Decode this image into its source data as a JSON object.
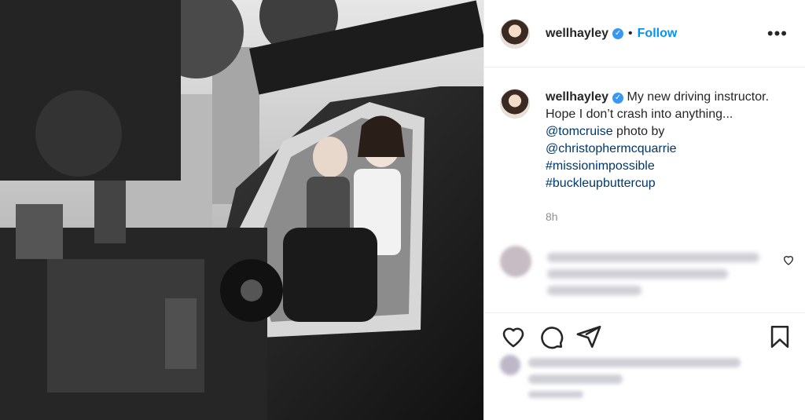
{
  "post": {
    "username": "wellhayley",
    "follow_label": "Follow",
    "more_label": "•••",
    "separator": "•",
    "caption": {
      "username": "wellhayley",
      "text_1": "My new driving instructor. Hope I don’t crash into anything... ",
      "mention_1": "@tomcruise",
      "text_2": " photo by ",
      "mention_2": "@christophermcquarrie",
      "hashtag_1": "#missionimpossible",
      "hashtag_2": "#buckleupbuttercup"
    },
    "age": "8h"
  },
  "icons": {
    "verified": "✓"
  },
  "colors": {
    "accent": "#0095f6",
    "verified": "#3897f0",
    "link": "#00376b"
  }
}
